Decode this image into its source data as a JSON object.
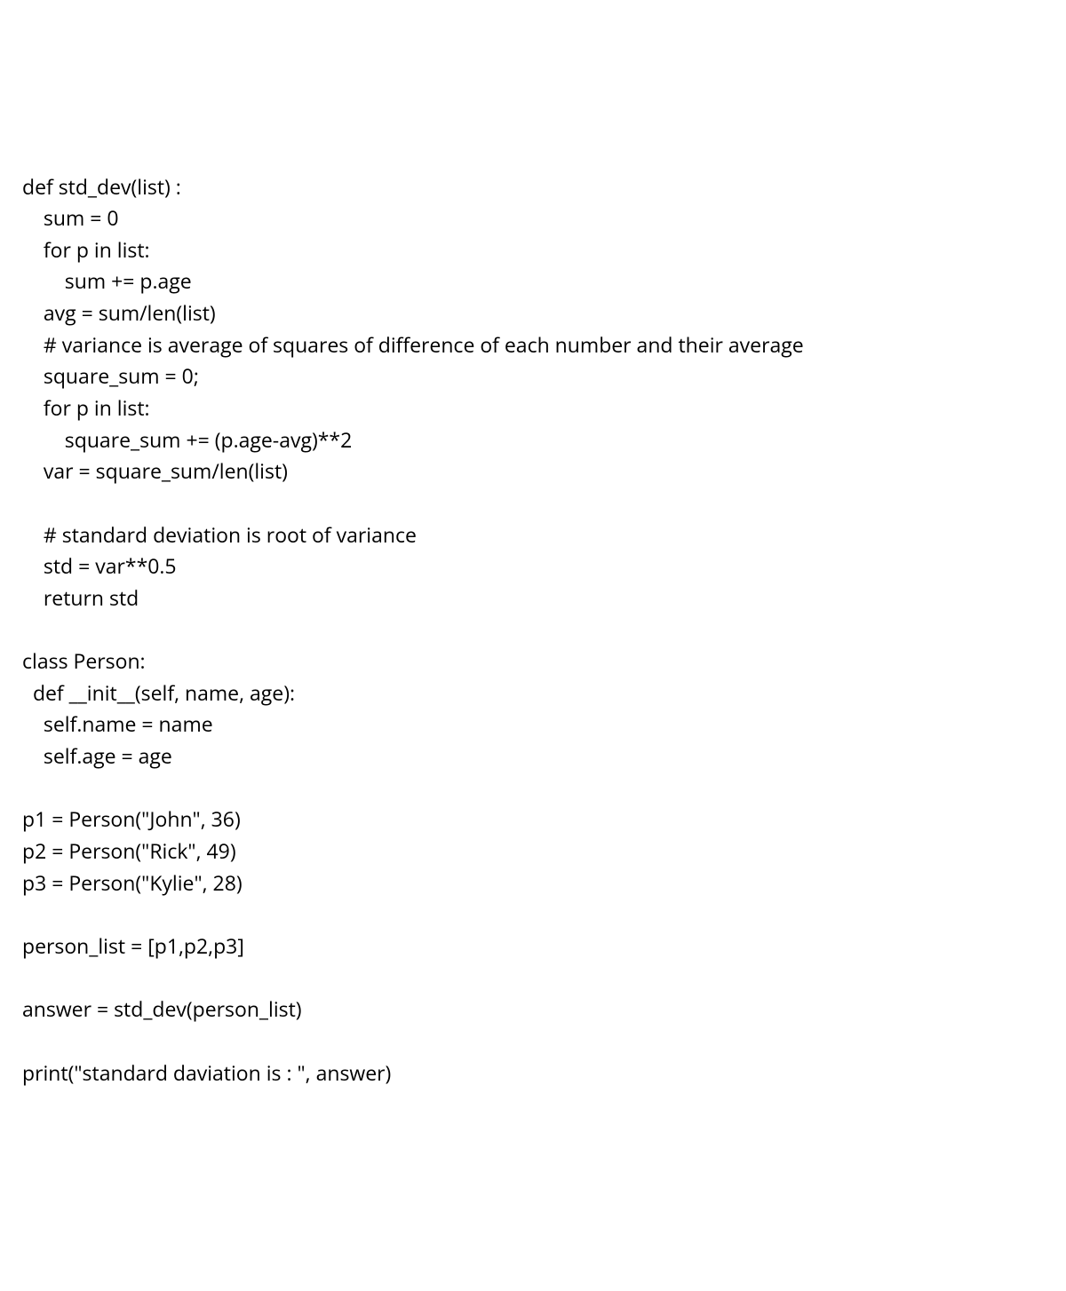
{
  "code": {
    "lines": [
      "def std_dev(list) :",
      "    sum = 0",
      "    for p in list:",
      "        sum += p.age",
      "    avg = sum/len(list)",
      "    # variance is average of squares of difference of each number and their average",
      "    square_sum = 0;",
      "    for p in list:",
      "        square_sum += (p.age-avg)**2",
      "    var = square_sum/len(list)",
      "",
      "    # standard deviation is root of variance",
      "    std = var**0.5",
      "    return std",
      "",
      "class Person:",
      "  def __init__(self, name, age):",
      "    self.name = name",
      "    self.age = age",
      "",
      "p1 = Person(\"John\", 36)",
      "p2 = Person(\"Rick\", 49)",
      "p3 = Person(\"Kylie\", 28)",
      "",
      "person_list = [p1,p2,p3]",
      "",
      "answer = std_dev(person_list)",
      "",
      "print(\"standard daviation is : \", answer)"
    ]
  }
}
